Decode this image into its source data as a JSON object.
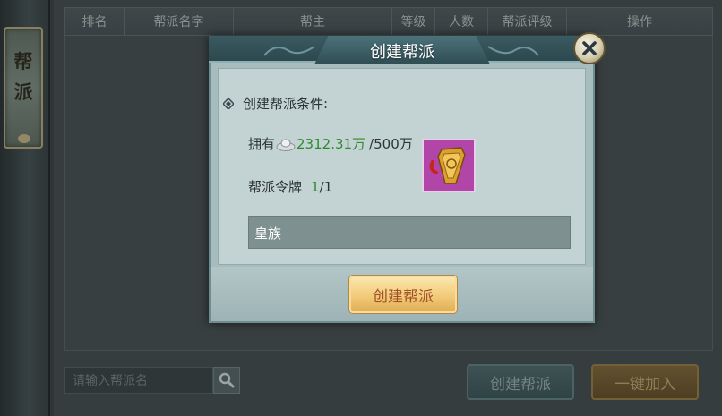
{
  "side_tab": {
    "label": "帮派"
  },
  "table": {
    "columns": [
      "排名",
      "帮派名字",
      "帮主",
      "等级",
      "人数",
      "帮派评级",
      "操作"
    ]
  },
  "bottom": {
    "search_placeholder": "请输入帮派名",
    "create_label": "创建帮派",
    "join_label": "一键加入"
  },
  "dialog": {
    "title": "创建帮派",
    "conditions_label": "创建帮派条件:",
    "own_label": "拥有",
    "own_value": "2312.31万",
    "own_required": "/500万",
    "token_label": "帮派令牌",
    "token_have": "1",
    "token_required": "/1",
    "name_value": "皇族",
    "create_button_label": "创建帮派"
  },
  "colors": {
    "accent_green": "#2f8a2f",
    "button_gold": "#f1c874",
    "token_bg": "#b245a8"
  },
  "icons": [
    "diamond-bullet-icon",
    "silver-ingot-icon",
    "guild-token-icon",
    "close-icon",
    "search-icon"
  ]
}
